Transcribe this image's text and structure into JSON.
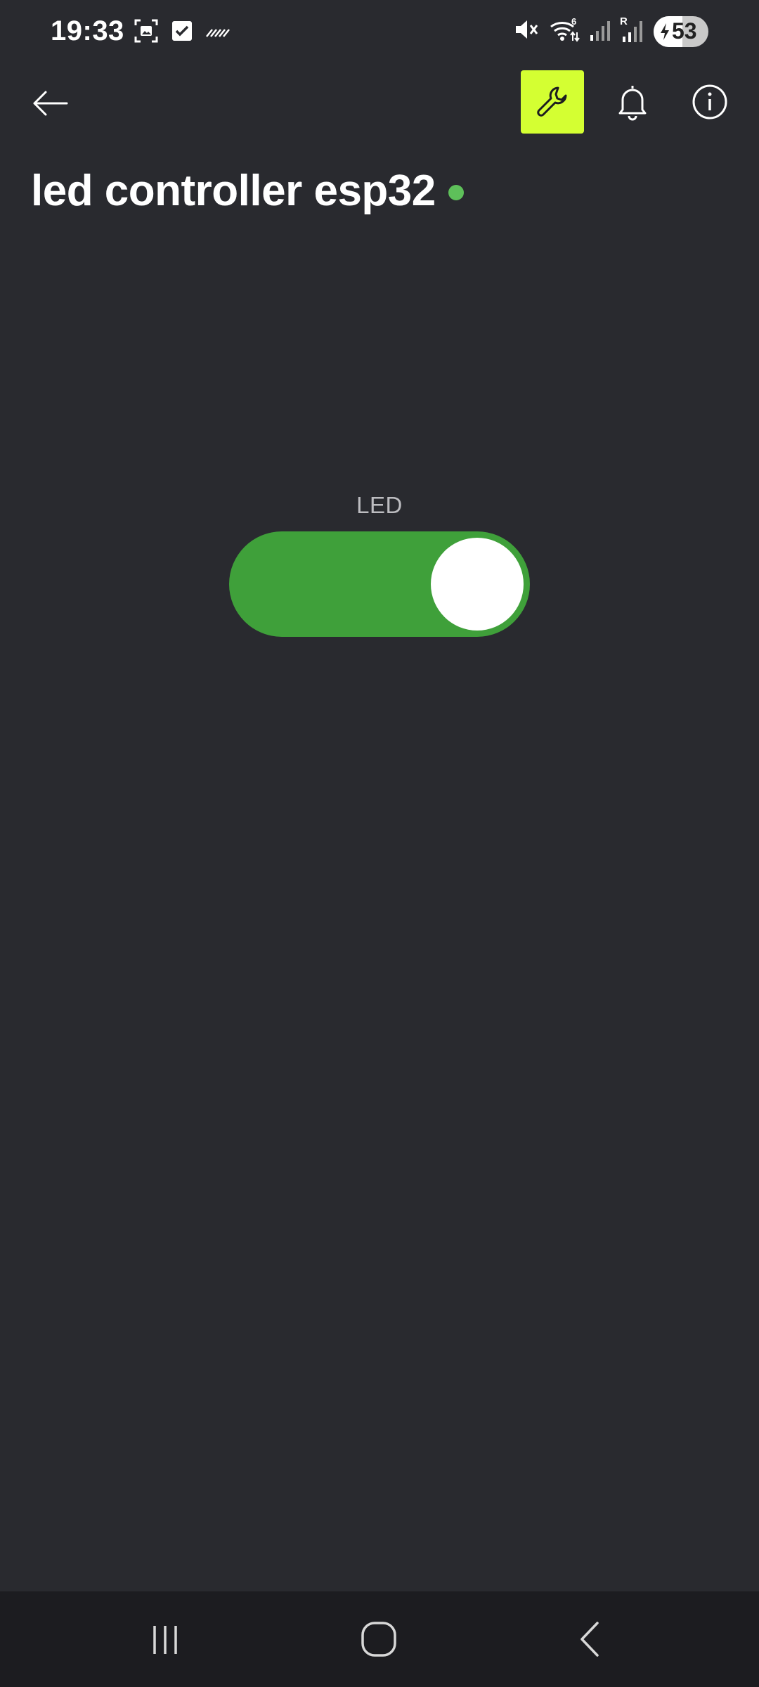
{
  "status_bar": {
    "time": "19:33",
    "battery_level": "53",
    "battery_fraction": 0.53,
    "left_icons": [
      "screenshot-icon",
      "checkbox-icon",
      "data-sync-icon"
    ],
    "right_icons": [
      "mute-icon",
      "wifi-icon",
      "signal-icon",
      "roaming-signal-icon",
      "battery-icon"
    ],
    "roaming_label": "R",
    "wifi_label": "6"
  },
  "header": {
    "back_icon": "arrow-left-icon",
    "actions": [
      {
        "name": "wrench-icon",
        "active": true
      },
      {
        "name": "bell-icon",
        "active": false
      },
      {
        "name": "info-icon",
        "active": false
      }
    ]
  },
  "device": {
    "title": "led controller esp32",
    "status_color": "#5ec05a",
    "online": true
  },
  "widget": {
    "label": "LED",
    "is_on": true,
    "on_color": "#3fa03a"
  },
  "nav_bar": {
    "buttons": [
      "recents-icon",
      "home-icon",
      "back-icon"
    ]
  },
  "colors": {
    "background": "#292a2f",
    "accent": "#d4ff32",
    "nav_background": "#1c1c20"
  }
}
